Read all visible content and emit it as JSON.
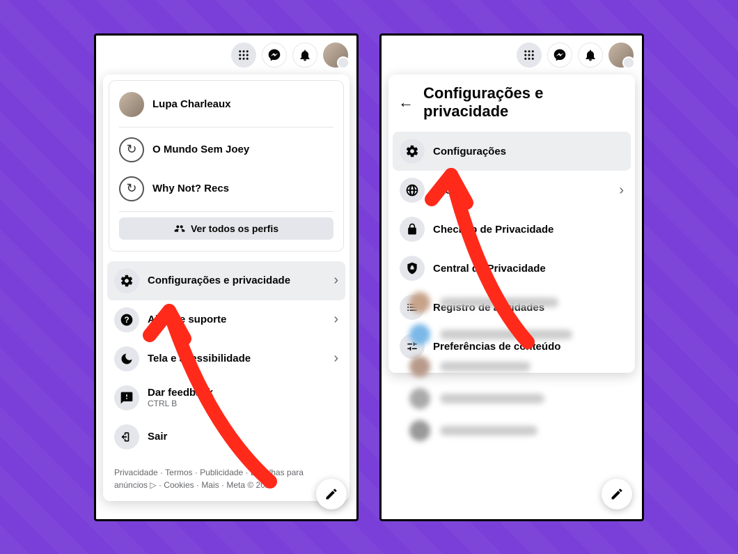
{
  "colors": {
    "accent": "#7a3fd8",
    "arrow": "#ff2a1a"
  },
  "header_icons": {
    "menu": "menu-grid-icon",
    "messenger": "messenger-icon",
    "notifications": "bell-icon",
    "avatar": "avatar-icon"
  },
  "panel1": {
    "profile": {
      "main_name": "Lupa Charleaux",
      "alt_profiles": [
        {
          "name": "O Mundo Sem Joey"
        },
        {
          "name": "Why Not? Recs"
        }
      ],
      "see_all_label": "Ver todos os perfis"
    },
    "menu": [
      {
        "key": "settings_privacy",
        "label": "Configurações e privacidade",
        "icon": "gear-icon",
        "chevron": true,
        "highlight": true
      },
      {
        "key": "help",
        "label": "Ajuda e suporte",
        "icon": "help-icon",
        "chevron": true
      },
      {
        "key": "display",
        "label": "Tela e acessibilidade",
        "icon": "moon-icon",
        "chevron": true
      },
      {
        "key": "feedback",
        "label": "Dar feedback",
        "sublabel": "CTRL B",
        "icon": "feedback-icon"
      },
      {
        "key": "logout",
        "label": "Sair",
        "icon": "logout-icon"
      }
    ],
    "footer_links": [
      "Privacidade",
      "Termos",
      "Publicidade",
      "Escolhas para anúncios",
      "Cookies",
      "Mais"
    ],
    "footer_meta": "Meta © 2025"
  },
  "panel2": {
    "title": "Configurações e privacidade",
    "menu": [
      {
        "key": "settings",
        "label": "Configurações",
        "icon": "gear-icon",
        "highlight": true
      },
      {
        "key": "language",
        "label": "Idioma",
        "icon": "globe-icon",
        "chevron": true
      },
      {
        "key": "privacy_checkup",
        "label": "Checkup de Privacidade",
        "icon": "lock-icon"
      },
      {
        "key": "privacy_center",
        "label": "Central de Privacidade",
        "icon": "shield-lock-icon"
      },
      {
        "key": "activity_log",
        "label": "Registro de atividades",
        "icon": "list-icon"
      },
      {
        "key": "content_prefs",
        "label": "Preferências de conteúdo",
        "icon": "sliders-icon"
      }
    ]
  }
}
